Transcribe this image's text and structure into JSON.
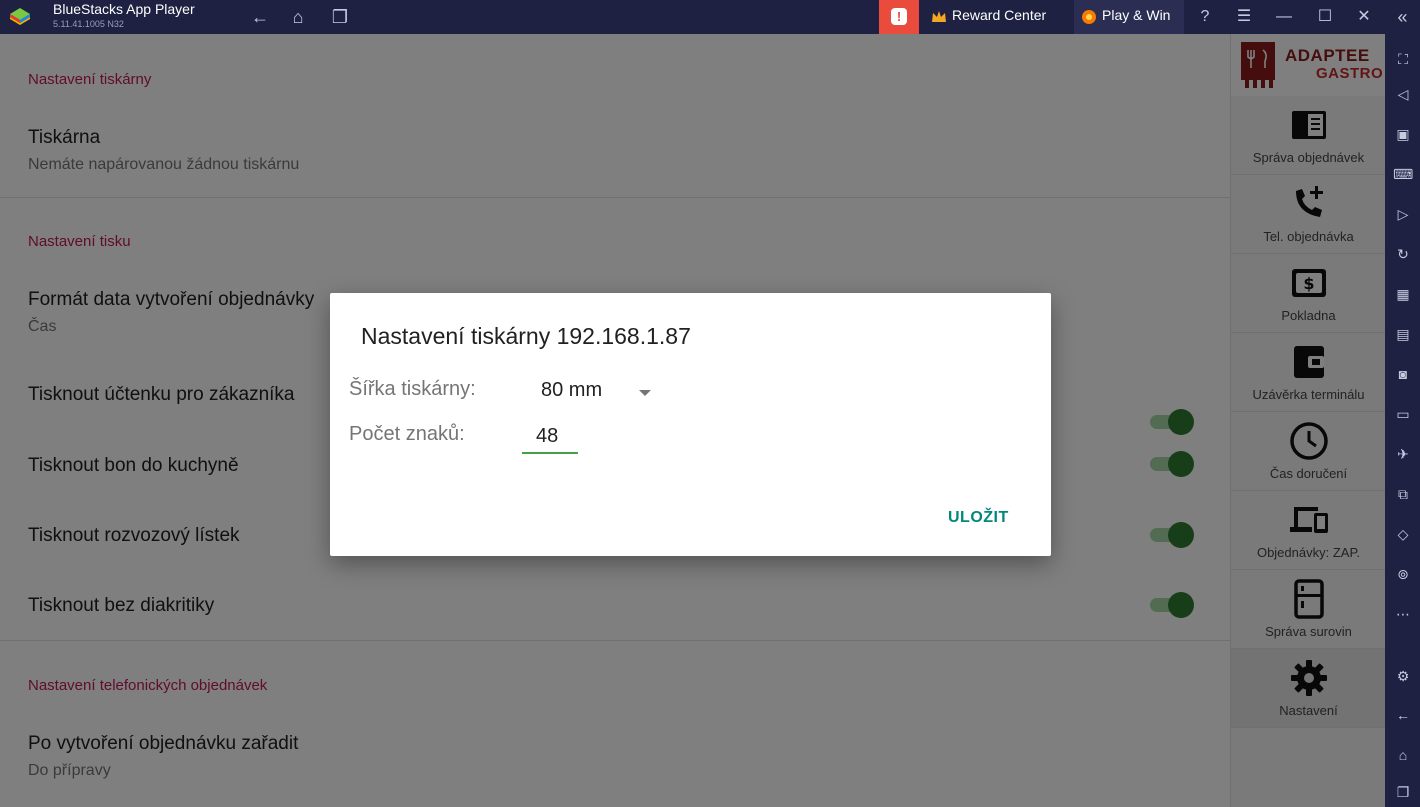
{
  "titlebar": {
    "app_name": "BlueStacks App Player",
    "version": "5.11.41.1005  N32",
    "reward_center": "Reward Center",
    "play_win": "Play & Win",
    "alert_glyph": "!"
  },
  "settings": {
    "sections": {
      "printer": "Nastavení tiskárny",
      "print": "Nastavení tisku",
      "phone": "Nastavení telefonických objednávek"
    },
    "printer_item": {
      "title": "Tiskárna",
      "subtitle": "Nemáte napárovanou žádnou tiskárnu"
    },
    "date_format": {
      "title": "Formát data vytvoření objednávky",
      "subtitle": "Čas"
    },
    "toggles": [
      {
        "label": "Tisknout účtenku pro zákazníka",
        "on": true
      },
      {
        "label": "Tisknout bon do kuchyně",
        "on": true
      },
      {
        "label": "Tisknout rozvozový lístek",
        "on": true
      },
      {
        "label": "Tisknout bez diakritiky",
        "on": true
      }
    ],
    "after_create": {
      "title": "Po vytvoření objednávku zařadit",
      "subtitle": "Do přípravy"
    }
  },
  "brand": {
    "line1": "ADAPTEE",
    "line2": "GASTRO"
  },
  "nav": [
    {
      "label": "Správa objednávek",
      "icon": "order-list-icon"
    },
    {
      "label": "Tel. objednávka",
      "icon": "phone-add-icon"
    },
    {
      "label": "Pokladna",
      "icon": "cash-register-icon"
    },
    {
      "label": "Uzávěrka terminálu",
      "icon": "wallet-icon"
    },
    {
      "label": "Čas doručení",
      "icon": "clock-icon"
    },
    {
      "label": "Objednávky: ZAP.",
      "icon": "devices-icon"
    },
    {
      "label": "Správa surovin",
      "icon": "fridge-icon"
    },
    {
      "label": "Nastavení",
      "icon": "gear-icon",
      "active": true
    }
  ],
  "dialog": {
    "title": "Nastavení tiskárny 192.168.1.87",
    "width_label": "Šířka tiskárny:",
    "width_value": "80 mm",
    "chars_label": "Počet znaků:",
    "chars_value": "48",
    "save": "ULOŽIT"
  },
  "colors": {
    "accent": "#c2185b",
    "toggle_on": "#2e7d32",
    "save": "#00897b",
    "titlebar": "#1e2142"
  }
}
